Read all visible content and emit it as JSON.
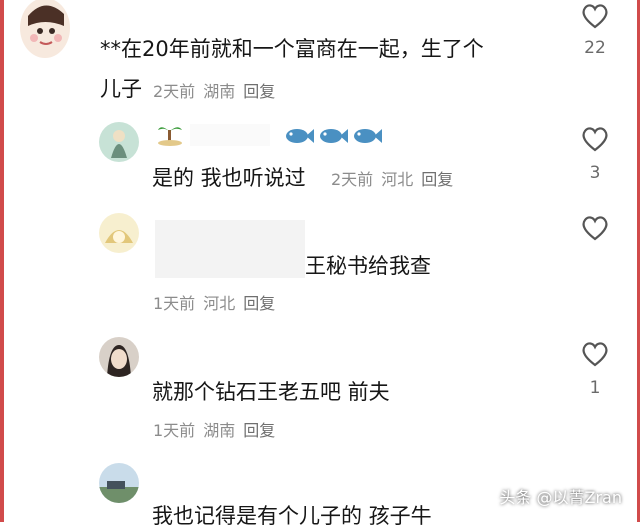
{
  "comments": [
    {
      "text": "**在20年前就和一个富商在一起，生了个",
      "text_line2": "儿子",
      "time": "2天前",
      "location": "湖南",
      "reply_label": "回复",
      "like_count": "22"
    },
    {
      "text": "是的 我也听说过",
      "time": "2天前",
      "location": "河北",
      "reply_label": "回复",
      "like_count": "3"
    },
    {
      "text": "王秘书给我查",
      "time": "1天前",
      "location": "河北",
      "reply_label": "回复",
      "like_count": ""
    },
    {
      "text": "就那个钻石王老五吧 前夫",
      "time": "1天前",
      "location": "湖南",
      "reply_label": "回复",
      "like_count": "1"
    },
    {
      "text": "我也记得是有个儿子的 孩子牛"
    }
  ],
  "watermark": "头条 @以菁Zran",
  "colors": {
    "frame": "#d14b4b",
    "fish": "#4a90c2"
  }
}
